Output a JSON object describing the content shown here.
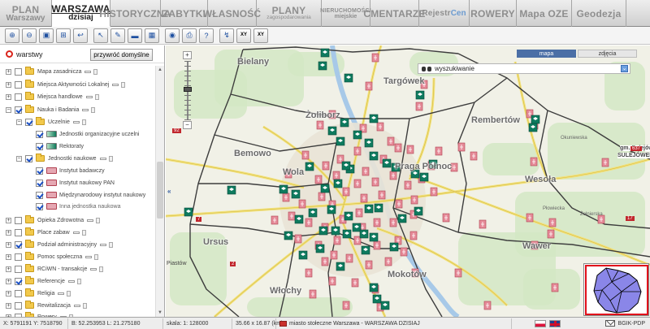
{
  "nav": {
    "tabs": [
      {
        "line1": "PLAN",
        "line2": "Warszawy"
      },
      {
        "line1": "WARSZAWA",
        "line2": "dzisiaj"
      },
      {
        "line1": "HISTORYCZNA",
        "line2": ""
      },
      {
        "line1": "ZABYTKI",
        "line2": ""
      },
      {
        "line1": "WŁASNOŚĆ",
        "line2": ""
      },
      {
        "line1": "PLANY",
        "line2": "zagospodarowania"
      },
      {
        "line1": "NIERUCHOMOŚCI",
        "line2": "miejskie"
      },
      {
        "line1": "CMENTARZE",
        "line2": ""
      },
      {
        "line1": "Rejestr ",
        "line1b": "Cen",
        "line2": ""
      },
      {
        "line1": "ROWERY",
        "line2": ""
      },
      {
        "line1": "Mapa OZE",
        "line2": ""
      },
      {
        "line1": "Geodezja",
        "line2": ""
      }
    ]
  },
  "toolbar": {
    "tools": [
      {
        "icon": "zoom-in-icon",
        "glyph": "⊕"
      },
      {
        "icon": "zoom-out-icon",
        "glyph": "⊖"
      },
      {
        "icon": "zoom-rect-icon",
        "glyph": "▣"
      },
      {
        "icon": "zoom-extent-icon",
        "glyph": "⊞"
      },
      {
        "icon": "zoom-back-icon",
        "glyph": "↩"
      },
      {
        "icon": "pointer-icon",
        "glyph": "↖"
      },
      {
        "icon": "info-icon",
        "glyph": "✎"
      },
      {
        "icon": "measure-icon",
        "glyph": "▬"
      },
      {
        "icon": "table-icon",
        "glyph": "▦"
      },
      {
        "icon": "globe-icon",
        "glyph": "◉"
      },
      {
        "icon": "print-icon",
        "glyph": "⎙"
      },
      {
        "icon": "help-icon",
        "glyph": "?"
      },
      {
        "icon": "route-icon",
        "glyph": "↯"
      },
      {
        "icon": "xy-locate-icon",
        "glyph": "XY"
      },
      {
        "icon": "xy-input-icon",
        "glyph": "XY"
      }
    ]
  },
  "layers": {
    "title": "warstwy",
    "reset_label": "przywróć domyślne",
    "items": [
      {
        "label": "Mapa zasadnicza",
        "checked": false,
        "level": 0,
        "type": "folder",
        "expander": "+",
        "minis": true
      },
      {
        "label": "Miejsca Aktywności Lokalnej",
        "checked": false,
        "level": 0,
        "type": "folder",
        "expander": "+",
        "minis": true
      },
      {
        "label": "Miejsca handlowe",
        "checked": false,
        "level": 0,
        "type": "folder",
        "expander": "+",
        "minis": true
      },
      {
        "label": "Nauka i Badania",
        "checked": true,
        "level": 0,
        "type": "folder",
        "expander": "−",
        "minis": true
      },
      {
        "label": "Uczelnie",
        "checked": true,
        "level": 1,
        "type": "folder",
        "expander": "−",
        "minis": true
      },
      {
        "label": "Jednostki organizacyjne uczelni",
        "checked": true,
        "level": 2,
        "type": "leaf",
        "icon": "grad",
        "minis": false
      },
      {
        "label": "Rektoraty",
        "checked": true,
        "level": 2,
        "type": "leaf",
        "icon": "grad",
        "minis": false
      },
      {
        "label": "Jednostki naukowe",
        "checked": true,
        "level": 1,
        "type": "folder",
        "expander": "−",
        "minis": true
      },
      {
        "label": "Instytut badawczy",
        "checked": true,
        "level": 2,
        "type": "leaf",
        "icon": "pink",
        "minis": false
      },
      {
        "label": "Instytut naukowy PAN",
        "checked": true,
        "level": 2,
        "type": "leaf",
        "icon": "pink",
        "minis": false
      },
      {
        "label": "Międzynarodowy instytut naukowy",
        "checked": true,
        "level": 2,
        "type": "leaf",
        "icon": "pink",
        "minis": false
      },
      {
        "label": "Inna jednostka naukowa",
        "checked": true,
        "level": 2,
        "type": "leaf",
        "icon": "pink",
        "minis": false,
        "grey": true
      },
      {
        "label": "Opieka Zdrowotna",
        "checked": false,
        "level": 0,
        "type": "folder",
        "expander": "+",
        "minis": true
      },
      {
        "label": "Place zabaw",
        "checked": false,
        "level": 0,
        "type": "folder",
        "expander": "+",
        "minis": true
      },
      {
        "label": "Podział administracyjny",
        "checked": true,
        "level": 0,
        "type": "folder",
        "expander": "+",
        "minis": true
      },
      {
        "label": "Pomoc społeczna",
        "checked": false,
        "level": 0,
        "type": "folder",
        "expander": "+",
        "minis": true
      },
      {
        "label": "RCiWN - transakcje",
        "checked": false,
        "level": 0,
        "type": "folder",
        "expander": "+",
        "minis": true
      },
      {
        "label": "Referencje",
        "checked": true,
        "level": 0,
        "type": "folder",
        "expander": "+",
        "minis": true
      },
      {
        "label": "Religia",
        "checked": false,
        "level": 0,
        "type": "folder",
        "expander": "+",
        "minis": true
      },
      {
        "label": "Rewitalizacja",
        "checked": false,
        "level": 0,
        "type": "folder",
        "expander": "+",
        "minis": true
      },
      {
        "label": "Rowery",
        "checked": false,
        "level": 0,
        "type": "folder",
        "expander": "+",
        "minis": true
      }
    ]
  },
  "map": {
    "view_buttons": {
      "map": "mapa",
      "photos": "zdjęcia"
    },
    "search_label": "wyszukiwanie",
    "collapse_arrow": "«",
    "zoom_in": "+",
    "zoom_out": "−",
    "district_labels": [
      "Bielany",
      "Targówek",
      "Żoliborz",
      "Rembertów",
      "Bemowo",
      "Praga Północ",
      "Wola",
      "Wesoła",
      "Ursus",
      "Wawer",
      "Włochy",
      "Mokotów"
    ],
    "street_labels": [
      "Piastów",
      "gm. Sulejówek",
      "SULEJÓWEK",
      "Okuniewska",
      "Żołnierska",
      "Płowiecka"
    ],
    "road_numbers": [
      "7",
      "2",
      "92",
      "17",
      "637"
    ],
    "colors": {
      "university": "#0e7a5e",
      "institute": "#e58a98",
      "boundary": "#3d3d3d",
      "roads": "#f2e27a"
    }
  },
  "status": {
    "coords": "X: 5791191 Y: 7518790",
    "latlon": "B: 52.253953 L: 21.275180",
    "scale": "skala: 1: 128000",
    "extent": "35.66 x 16.87 (km)",
    "layer_name": "miasto stołeczne Warszawa - WARSZAWA DZISIAJ",
    "code": "BGIK-PDP"
  }
}
